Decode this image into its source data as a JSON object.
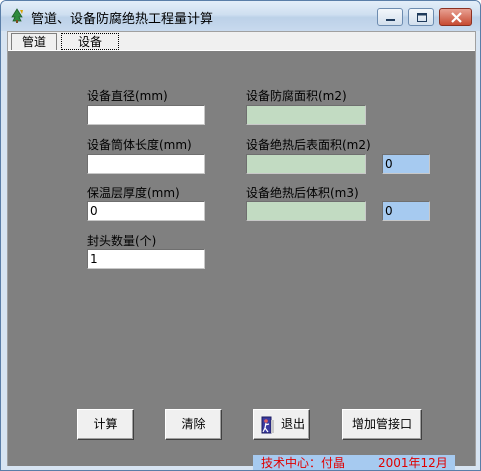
{
  "window": {
    "title": "管道、设备防腐绝热工程量计算",
    "app_icon": "app-tree-icon"
  },
  "tabs": [
    {
      "label": "管道",
      "active": false
    },
    {
      "label": "设备",
      "active": true
    }
  ],
  "form": {
    "diameter_label": "设备直径(mm)",
    "diameter_value": "",
    "length_label": "设备筒体长度(mm)",
    "length_value": "",
    "insulation_label": "保温层厚度(mm)",
    "insulation_value": "0",
    "heads_label": "封头数量(个)",
    "heads_value": "1",
    "anticorrosion_area_label": "设备防腐面积(m2)",
    "anticorrosion_area_value": "",
    "surface_area_label": "设备绝热后表面积(m2)",
    "surface_area_value": "",
    "surface_area_extra": "0",
    "volume_label": "设备绝热后体积(m3)",
    "volume_value": "",
    "volume_extra": "0"
  },
  "buttons": {
    "calculate": "计算",
    "clear": "清除",
    "exit": "退出",
    "add_nozzle": "增加管接口"
  },
  "footer": {
    "credit": "技术中心：付晶",
    "date": "2001年12月"
  },
  "colors": {
    "pane_bg": "#808080",
    "result_field": "#c2dbc2",
    "extra_field": "#a6caf0",
    "footer_text": "#e00000"
  }
}
